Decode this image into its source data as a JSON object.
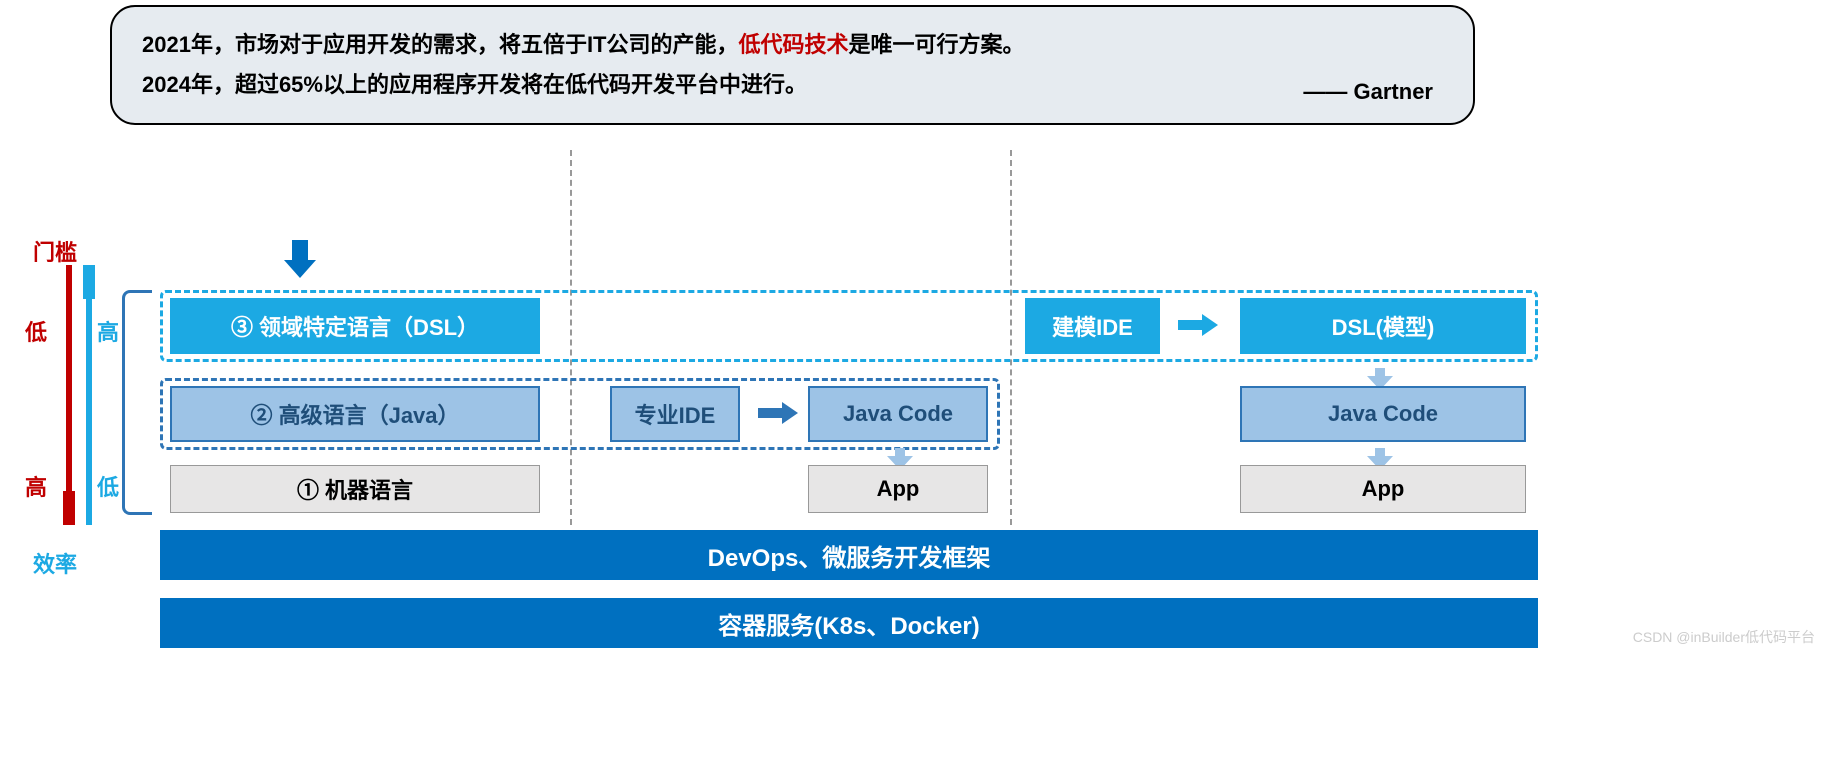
{
  "quote": {
    "line1_a": "2021年，市场对于应用开发的需求，将五倍于IT公司的产能，",
    "line1_b": "低代码技术",
    "line1_c": "是唯一可行方案。",
    "line2": "2024年，超过65%以上的应用程序开发将在低代码开发平台中进行。",
    "source": "—— Gartner"
  },
  "axis": {
    "top": "门槛",
    "bottom": "效率",
    "red_low": "低",
    "red_high": "高",
    "blue_high": "高",
    "blue_low": "低"
  },
  "layers": {
    "dsl": "③ 领域特定语言（DSL）",
    "java": "② 高级语言（Java）",
    "machine": "① 机器语言",
    "model_ide": "建模IDE",
    "dsl_model": "DSL(模型)",
    "pro_ide": "专业IDE",
    "java_code": "Java Code",
    "java_code_2": "Java Code",
    "app1": "App",
    "app2": "App",
    "devops": "DevOps、微服务开发框架",
    "k8s": "容器服务(K8s、Docker)"
  },
  "watermark": "CSDN @inBuilder低代码平台"
}
